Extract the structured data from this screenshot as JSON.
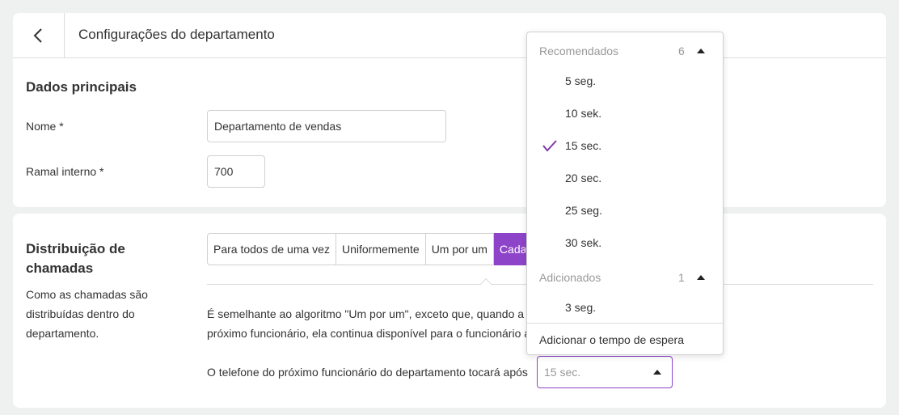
{
  "header": {
    "title": "Configurações do departamento",
    "back_icon": "chevron-left-icon"
  },
  "main_section": {
    "title": "Dados principais",
    "name_label": "Nome *",
    "name_value": "Departamento de vendas",
    "ext_label": "Ramal interno *",
    "ext_value": "700"
  },
  "distribution": {
    "title_line1": "Distribuição de",
    "title_line2": "chamadas",
    "desc_line1": "Como as chamadas são",
    "desc_line2": "distribuídas dentro do",
    "desc_line3": "departamento.",
    "modes": [
      "Para todos de uma vez",
      "Uniformemente",
      "Um por um",
      "Cada"
    ],
    "active_mode_index": 3,
    "algo_line1": "É semelhante ao algoritmo \"Um por um\", exceto que, quando a c",
    "algo_line2": "próximo funcionário, ela continua disponível para o funcionário a",
    "ring_label": "O telefone do próximo funcionário do departamento tocará após",
    "ring_value": "15 sec."
  },
  "dropdown": {
    "recommended": {
      "label": "Recomendados",
      "count": "6"
    },
    "options": [
      "5 seg.",
      "10 sek.",
      "15 sec.",
      "20 sec.",
      "25 seg.",
      "30 sek."
    ],
    "selected_index": 2,
    "added": {
      "label": "Adicionados",
      "count": "1"
    },
    "added_options": [
      "3 seg."
    ],
    "add_action": "Adicionar o tempo de espera"
  },
  "colors": {
    "accent": "#8e44c8",
    "background": "#eff0f0"
  }
}
